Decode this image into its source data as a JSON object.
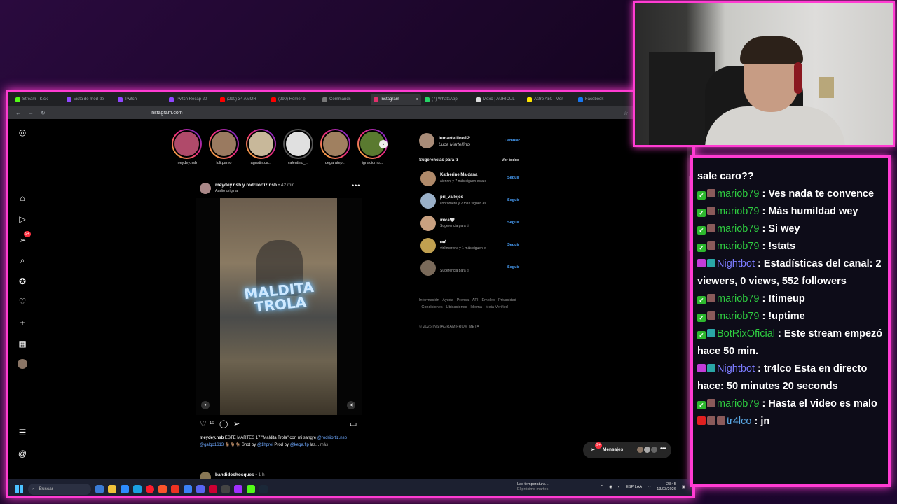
{
  "browser": {
    "tabs": [
      {
        "label": "Stream - Kick",
        "color": "#53fc18",
        "active": false
      },
      {
        "label": "Vista de mod de",
        "color": "#9146ff",
        "active": false
      },
      {
        "label": "Twitch",
        "color": "#9146ff",
        "active": false
      },
      {
        "label": "Twitch Recap 20",
        "color": "#9146ff",
        "active": false
      },
      {
        "label": "(290) 34 AMOR",
        "color": "#ff0000",
        "active": false
      },
      {
        "label": "(290) Homer el i",
        "color": "#ff0000",
        "active": false
      },
      {
        "label": "Commands",
        "color": "#777777",
        "active": false
      },
      {
        "label": "Instagram",
        "color": "#e1306c",
        "active": true
      },
      {
        "label": "(7) WhatsApp",
        "color": "#25d366",
        "active": false
      },
      {
        "label": "Mexo | AURICUL",
        "color": "#dddddd",
        "active": false
      },
      {
        "label": "Astro A50 | Mer",
        "color": "#ffe600",
        "active": false
      },
      {
        "label": "Facebook",
        "color": "#1877f2",
        "active": false
      }
    ],
    "url": "instagram.com"
  },
  "stories": [
    {
      "name": "meydey.nsb",
      "seen": false
    },
    {
      "name": "luli.pamo",
      "seen": false
    },
    {
      "name": "agustin.ca...",
      "seen": false
    },
    {
      "name": "valentino_...",
      "seen": true
    },
    {
      "name": "degaratep...",
      "seen": false
    },
    {
      "name": "ignaciomu...",
      "seen": false
    }
  ],
  "post": {
    "user": "meydey.nsb y rodriiortiz.nsb",
    "time": "• 42 min",
    "audio": "Audio original",
    "media_text": "MALDITA TROLA",
    "likes": "10",
    "caption_user": "meydey.nsb",
    "caption_text": " ESTE MARTES 17 \"Maldita Trola\" con mi sangre ",
    "caption_tag1": "@rodriiortiz.nsb",
    "caption_tag2": " @galgo1613",
    "caption_mid": " 🐐🐐🐐 Shot by ",
    "caption_tag3": "@1hprei",
    "caption_end": " Prod by ",
    "caption_tag4": "@kega.flp",
    "caption_rest": " las...",
    "caption_more": " más",
    "next_user": "bandidoshosques",
    "next_time": "• 1 h"
  },
  "me": {
    "user": "lumartellino12",
    "name": "Luca Martellino",
    "switch": "Cambiar"
  },
  "suggestions_header": {
    "title": "Sugerencias para ti",
    "see_all": "Ver todos"
  },
  "suggestions": [
    {
      "user": "Katherine Maidana",
      "sub": "aiennnj y 7 más siguen esta c",
      "follow": "Seguir"
    },
    {
      "user": "pri_vallejos",
      "sub": "coorornero y 2 más siguen es",
      "follow": "Seguir"
    },
    {
      "user": "mica🤍",
      "sub": "Sugerencia para ti",
      "follow": "Seguir"
    },
    {
      "user": "𝒸𝒶𝓉",
      "sub": "vinkmorena y 1 más siguen e",
      "follow": "Seguir"
    },
    {
      "user": ".",
      "sub": "Sugerencia para ti",
      "follow": "Seguir"
    }
  ],
  "footer": {
    "links": "Información · Ayuda · Prensa · API · Empleo · Privacidad · Condiciones · Ubicaciones · Idioma · Meta Verified",
    "copyright": "© 2026 INSTAGRAM FROM META"
  },
  "messages": {
    "label": "Mensajes",
    "badge": "9+"
  },
  "nav_badge": "9+",
  "taskbar": {
    "search": "Buscar",
    "weather_title": "Las temperatura...",
    "weather_sub": "El próximo martes",
    "lang": "ESP LAA",
    "time": "23:45",
    "date": "13/03/2026"
  },
  "chat": {
    "snip": "sale caro??",
    "messages": [
      {
        "user": "mariob79",
        "color": "#2ecc40",
        "badges": [
          "check",
          "mod"
        ],
        "text": ": Ves nada te convence"
      },
      {
        "user": "mariob79",
        "color": "#2ecc40",
        "badges": [
          "check",
          "mod"
        ],
        "text": ": Más humildad wey"
      },
      {
        "user": "mariob79",
        "color": "#2ecc40",
        "badges": [
          "check",
          "mod"
        ],
        "text": ": Si wey"
      },
      {
        "user": "mariob79",
        "color": "#2ecc40",
        "badges": [
          "check",
          "mod"
        ],
        "text": ": !stats"
      },
      {
        "user": "Nightbot",
        "color": "#7b7bff",
        "badges": [
          "bot",
          "tv"
        ],
        "text": ": Estadísticas del canal: 2 viewers, 0 views, 552 followers"
      },
      {
        "user": "mariob79",
        "color": "#2ecc40",
        "badges": [
          "check",
          "mod"
        ],
        "text": ": !timeup"
      },
      {
        "user": "mariob79",
        "color": "#2ecc40",
        "badges": [
          "check",
          "mod"
        ],
        "text": ": !uptime"
      },
      {
        "user": "BotRixOficial",
        "color": "#2ecc40",
        "badges": [
          "check",
          "tv"
        ],
        "text": ": Este stream empezó hace 50 min."
      },
      {
        "user": "Nightbot",
        "color": "#7b7bff",
        "badges": [
          "bot",
          "tv"
        ],
        "text": ": tr4lco Esta en directo hace: 50 minutes 20 seconds"
      },
      {
        "user": "mariob79",
        "color": "#2ecc40",
        "badges": [
          "check",
          "mod"
        ],
        "text": ": Hasta el video es malo"
      },
      {
        "user": "tr4lco",
        "color": "#5aa9e6",
        "badges": [
          "red",
          "mod",
          "mod"
        ],
        "text": ": jn"
      }
    ]
  }
}
